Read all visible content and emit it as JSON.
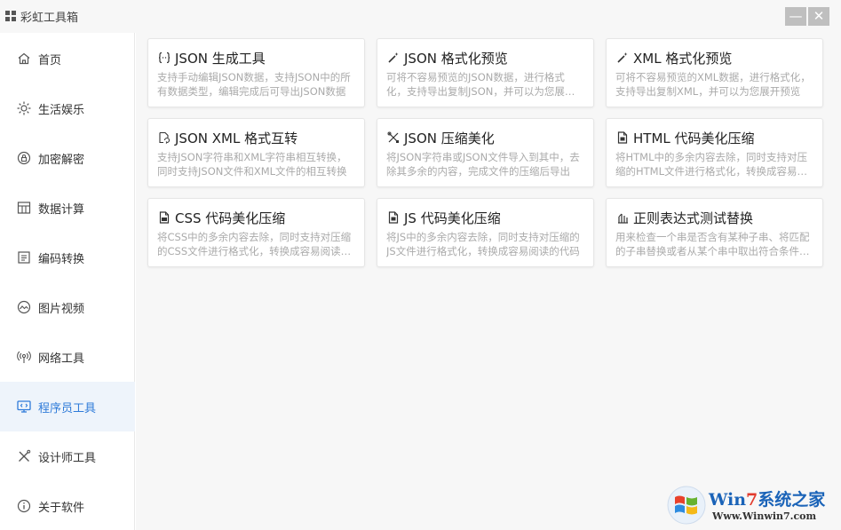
{
  "window": {
    "title": "彩虹工具箱",
    "min_label": "—",
    "close_label": "✕"
  },
  "sidebar": {
    "items": [
      {
        "label": "首页",
        "icon": "home-icon"
      },
      {
        "label": "生活娱乐",
        "icon": "sun-icon"
      },
      {
        "label": "加密解密",
        "icon": "lock-icon"
      },
      {
        "label": "数据计算",
        "icon": "calculator-icon"
      },
      {
        "label": "编码转换",
        "icon": "code-icon"
      },
      {
        "label": "图片视频",
        "icon": "image-icon"
      },
      {
        "label": "网络工具",
        "icon": "network-icon"
      },
      {
        "label": "程序员工具",
        "icon": "monitor-icon",
        "active": true
      },
      {
        "label": "设计师工具",
        "icon": "design-icon"
      },
      {
        "label": "关于软件",
        "icon": "info-icon"
      }
    ],
    "active_color": "#2f7bd9"
  },
  "cards": [
    {
      "title": "JSON 生成工具",
      "icon": "braces-icon",
      "desc": "支持手动编辑JSON数据，支持JSON中的所有数据类型，编辑完成后可导出JSON数据"
    },
    {
      "title": "JSON 格式化预览",
      "icon": "wand-icon",
      "desc": "可将不容易预览的JSON数据，进行格式化，支持导出复制JSON，并可以为您展开预览"
    },
    {
      "title": "XML 格式化预览",
      "icon": "wand-icon",
      "desc": "可将不容易预览的XML数据，进行格式化，支持导出复制XML，并可以为您展开预览"
    },
    {
      "title": "JSON XML 格式互转",
      "icon": "convert-icon",
      "desc": "支持JSON字符串和XML字符串相互转换，同时支持JSON文件和XML文件的相互转换"
    },
    {
      "title": "JSON 压缩美化",
      "icon": "tools-icon",
      "desc": "将JSON字符串或JSON文件导入到其中，去除其多余的内容，完成文件的压缩后导出"
    },
    {
      "title": "HTML 代码美化压缩",
      "icon": "file-code-icon",
      "desc": "将HTML中的多余内容去除，同时支持对压缩的HTML文件进行格式化，转换成容易阅读的代码"
    },
    {
      "title": "CSS 代码美化压缩",
      "icon": "file-code-icon",
      "desc": "将CSS中的多余内容去除，同时支持对压缩的CSS文件进行格式化，转换成容易阅读的代码"
    },
    {
      "title": "JS 代码美化压缩",
      "icon": "file-code-icon",
      "desc": "将JS中的多余内容去除，同时支持对压缩的JS文件进行格式化，转换成容易阅读的代码"
    },
    {
      "title": "正则表达式测试替换",
      "icon": "regex-icon",
      "desc": "用来检查一个串是否含有某种子串、将匹配的子串替换或者从某个串中取出符合条件的子串"
    }
  ],
  "watermark": {
    "title_prefix": "Win",
    "title_num": "7",
    "title_suffix": "系统之家",
    "url": "Www.Winwin7.com"
  }
}
